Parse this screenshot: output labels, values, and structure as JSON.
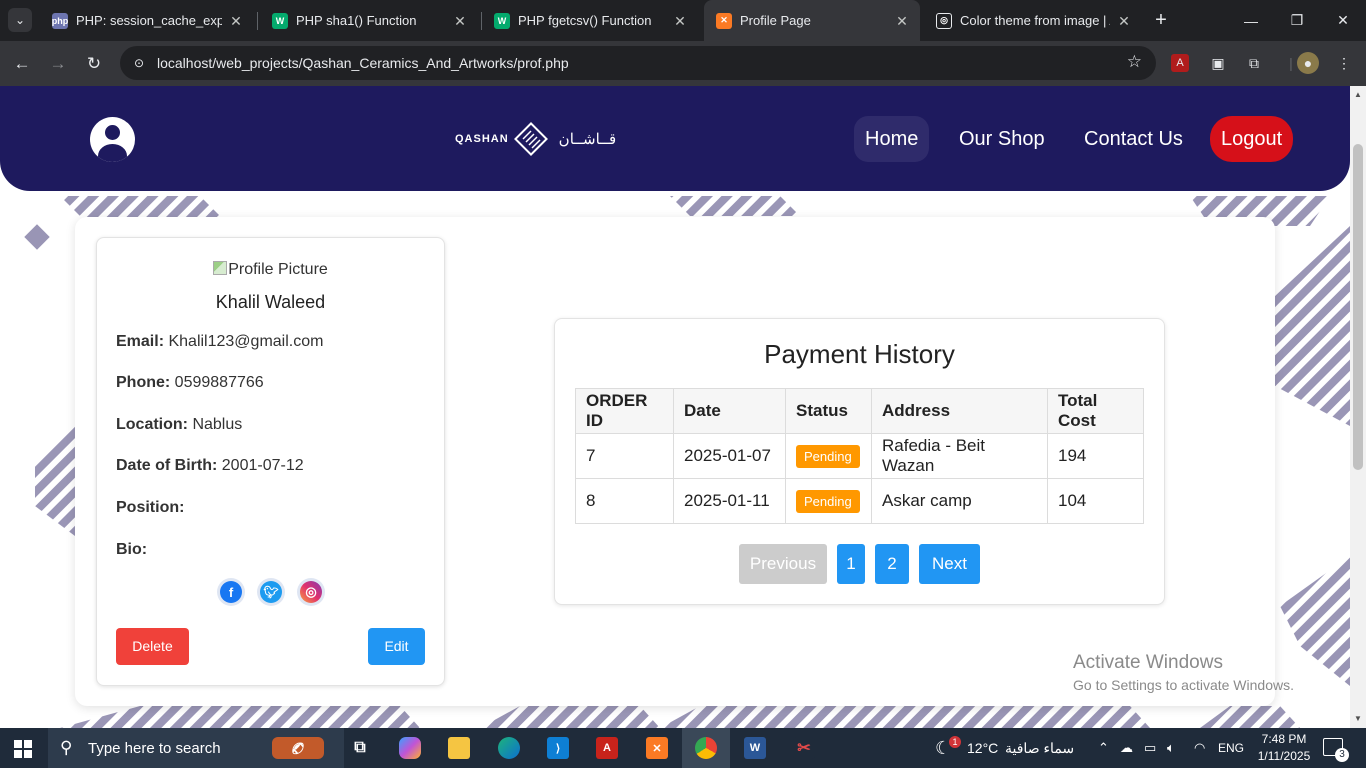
{
  "browser": {
    "tabs": [
      {
        "title": "PHP: session_cache_expire -",
        "favicon": "php-icon",
        "active": false
      },
      {
        "title": "PHP sha1() Function",
        "favicon": "w3schools-icon",
        "active": false
      },
      {
        "title": "PHP fgetcsv() Function",
        "favicon": "w3schools-icon",
        "active": false
      },
      {
        "title": "Profile Page",
        "favicon": "xampp-icon",
        "active": true
      },
      {
        "title": "Color theme from image | Ac",
        "favicon": "adobe-color-icon",
        "active": false
      }
    ],
    "url": "localhost/web_projects/Qashan_Ceramics_And_Artworks/prof.php"
  },
  "site": {
    "logo_en": "QASHAN",
    "logo_ar": "قــاشــان",
    "nav": {
      "home": "Home",
      "shop": "Our Shop",
      "contact": "Contact Us",
      "logout": "Logout"
    },
    "colors": {
      "header": "#1e1a5e",
      "logout": "#d61019",
      "primary": "#2196f3",
      "danger": "#f0413a",
      "pending": "#ff9800"
    }
  },
  "profile": {
    "picture_alt": "Profile Picture",
    "name": "Khalil Waleed",
    "email_label": "Email:",
    "email": "Khalil123@gmail.com",
    "phone_label": "Phone:",
    "phone": "0599887766",
    "location_label": "Location:",
    "location": "Nablus",
    "dob_label": "Date of Birth:",
    "dob": "2001-07-12",
    "position_label": "Position:",
    "position": "",
    "bio_label": "Bio:",
    "bio": "",
    "socials": [
      "facebook-icon",
      "twitter-icon",
      "instagram-icon"
    ],
    "delete_label": "Delete",
    "edit_label": "Edit"
  },
  "payment": {
    "title": "Payment History",
    "headers": [
      "ORDER ID",
      "Date",
      "Status",
      "Address",
      "Total Cost"
    ],
    "rows": [
      {
        "id": "7",
        "date": "2025-01-07",
        "status": "Pending",
        "address": "Rafedia - Beit Wazan",
        "total": "194"
      },
      {
        "id": "8",
        "date": "2025-01-11",
        "status": "Pending",
        "address": "Askar camp",
        "total": "104"
      }
    ],
    "pagination": {
      "previous": "Previous",
      "page1": "1",
      "page2": "2",
      "next": "Next"
    }
  },
  "watermark": {
    "line1": "Activate Windows",
    "line2": "Go to Settings to activate Windows."
  },
  "taskbar": {
    "search_placeholder": "Type here to search",
    "weather_temp": "12°C",
    "weather_desc": "سماء صافية",
    "weather_badge": "1",
    "language": "ENG",
    "time": "7:48 PM",
    "date": "1/11/2025",
    "notifications": "3"
  }
}
